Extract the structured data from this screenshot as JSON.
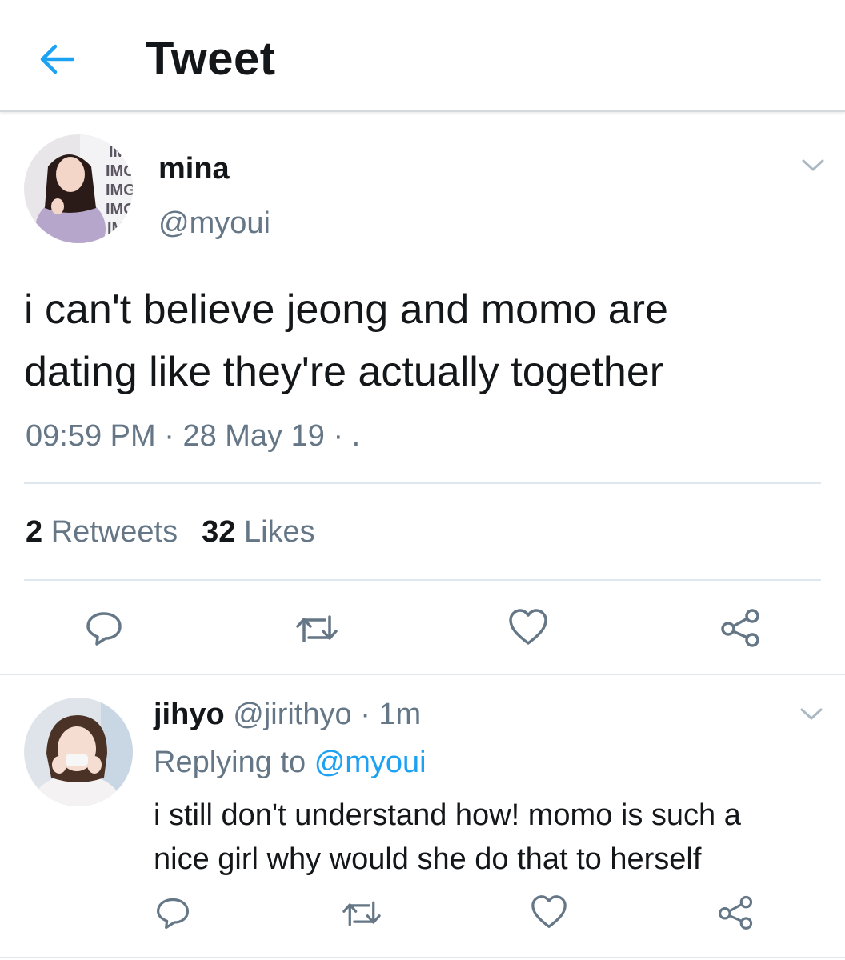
{
  "header": {
    "title": "Tweet",
    "back_icon": "arrow-left-icon",
    "accent_color": "#1da1f2"
  },
  "tweet": {
    "name": "mina",
    "handle": "@myoui",
    "avatar_text": [
      "IM",
      "IMG",
      "IMG",
      "IMG",
      "IM"
    ],
    "text_line1": "i can't believe jeong and momo are",
    "text_line2": "dating like they're actually together",
    "time": "09:59 PM",
    "sep": "·",
    "date": "28 May 19",
    "trail": "· .",
    "retweets_count": "2",
    "retweets_label": "Retweets",
    "likes_count": "32",
    "likes_label": "Likes"
  },
  "reply": {
    "name": "jihyo",
    "handle": "@jirithyo",
    "sep": "·",
    "time": "1m",
    "replying_prefix": "Replying to",
    "replying_to": "@myoui",
    "text_line1": "i still don't understand how! momo is such a",
    "text_line2": "nice girl why would she do that to herself"
  },
  "actions": [
    "reply-icon",
    "retweet-icon",
    "like-icon",
    "share-icon"
  ],
  "colors": {
    "text": "#14171a",
    "secondary": "#657786",
    "link": "#1da1f2",
    "icon": "#657786"
  }
}
